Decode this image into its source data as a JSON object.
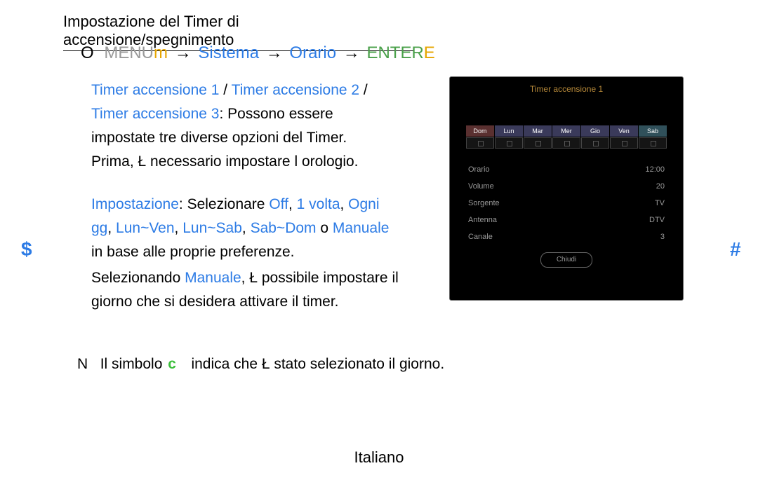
{
  "title": "Impostazione del Timer di accensione/spegnimento",
  "breadcrumb": {
    "o": "O",
    "menu": "MENU",
    "m": "m",
    "sep": "→",
    "sistema": "Sistema",
    "orario": "Orario",
    "enter": "ENTER",
    "e": "E"
  },
  "para1": {
    "t1": "Timer accensione 1",
    "slash1": " / ",
    "t2": "Timer accensione 2",
    "slash2": " / ",
    "t3": "Timer accensione 3",
    "rest": ": Possono essere impostate tre diverse opzioni del Timer. Prima, Ł necessario impostare l orologio."
  },
  "para2": {
    "imp": "Impostazione",
    "colon": ": Selezionare ",
    "off": "Off",
    "c1": ", ",
    "v1": "1 volta",
    "c2": ", ",
    "ogni": "Ogni gg",
    "c3": ", ",
    "lv": "Lun~Ven",
    "c4": ", ",
    "ls": "Lun~Sab",
    "c5": ", ",
    "sd": "Sab~Dom",
    "o": " o ",
    "man": "Manuale",
    "rest1": " in base alle proprie preferenze."
  },
  "para3": {
    "pre": "Selezionando ",
    "man": "Manuale",
    "rest": ", Ł possibile impostare il giorno che si desidera attivare il timer."
  },
  "note": {
    "n": "N",
    "pre": "Il simbolo",
    "c": "c",
    "rest": "indica che Ł stato selezionato il giorno."
  },
  "left_symbol": "$",
  "right_symbol": "#",
  "footer": "Italiano",
  "panel": {
    "title": "Timer accensione 1",
    "days": [
      "Dom",
      "Lun",
      "Mar",
      "Mer",
      "Gio",
      "Ven",
      "Sab"
    ],
    "rows": [
      {
        "label": "Orario",
        "value": "12:00"
      },
      {
        "label": "Volume",
        "value": "20"
      },
      {
        "label": "Sorgente",
        "value": "TV"
      },
      {
        "label": "Antenna",
        "value": "DTV"
      },
      {
        "label": "Canale",
        "value": "3"
      }
    ],
    "close": "Chiudi"
  }
}
